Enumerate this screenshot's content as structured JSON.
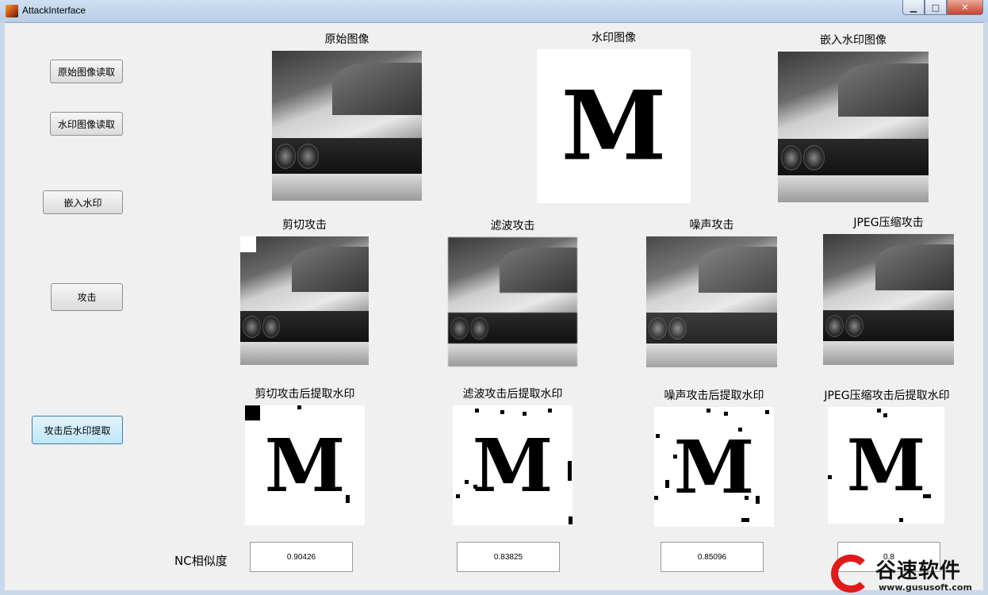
{
  "window": {
    "title": "AttackInterface",
    "min": "▁",
    "max": "□",
    "close": "✕"
  },
  "buttons": {
    "load_original": "原始图像读取",
    "load_watermark": "水印图像读取",
    "embed": "嵌入水印",
    "attack": "攻击",
    "extract": "攻击后水印提取"
  },
  "images": {
    "original": "原始图像",
    "watermark": "水印图像",
    "embedded": "嵌入水印图像",
    "crop": "剪切攻击",
    "filter": "滤波攻击",
    "noise": "噪声攻击",
    "jpeg": "JPEG压缩攻击",
    "extract_crop": "剪切攻击后提取水印",
    "extract_filter": "滤波攻击后提取水印",
    "extract_noise": "噪声攻击后提取水印",
    "extract_jpeg": "JPEG压缩攻击后提取水印"
  },
  "watermark_letter": "M",
  "nc": {
    "label": "NC相似度",
    "crop": "0.90426",
    "filter": "0.83825",
    "noise": "0.85096",
    "jpeg": "0.8"
  },
  "logo": {
    "name": "谷速软件",
    "url": "www.gususoft.com"
  }
}
